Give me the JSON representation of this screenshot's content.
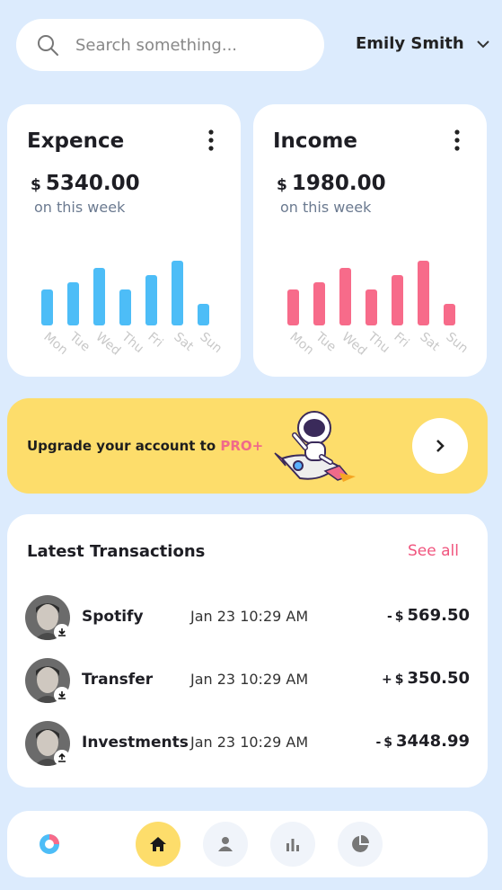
{
  "search": {
    "placeholder": "Search something..."
  },
  "user": {
    "name": "Emily Smith"
  },
  "expense": {
    "title": "Expence",
    "currency": "$",
    "amount": "5340.00",
    "subtitle": "on this week",
    "color": "#4dbdf7",
    "days": [
      "Mon",
      "Tue",
      "Wed",
      "Thu",
      "Fri",
      "Sat",
      "Sun"
    ],
    "values": [
      40,
      48,
      64,
      40,
      56,
      72,
      24
    ]
  },
  "income": {
    "title": "Income",
    "currency": "$",
    "amount": "1980.00",
    "subtitle": "on this week",
    "color": "#f76b8a",
    "days": [
      "Mon",
      "Tue",
      "Wed",
      "Thu",
      "Fri",
      "Sat",
      "Sun"
    ],
    "values": [
      40,
      48,
      64,
      40,
      56,
      72,
      24
    ]
  },
  "promo": {
    "text": "Upgrade your account to ",
    "highlight": "PRO+"
  },
  "transactions": {
    "title": "Latest Transactions",
    "see_all": "See all",
    "items": [
      {
        "name": "Spotify",
        "date": "Jan 23 10:29 AM",
        "sign": "-",
        "currency": "$",
        "amount": "569.50"
      },
      {
        "name": "Transfer",
        "date": "Jan 23 10:29 AM",
        "sign": "+",
        "currency": "$",
        "amount": "350.50"
      },
      {
        "name": "Investments",
        "date": "Jan 23 10:29 AM",
        "sign": "-",
        "currency": "$",
        "amount": "3448.99"
      }
    ]
  },
  "nav": {
    "items": [
      "home-icon",
      "user-icon",
      "bar-chart-icon",
      "pie-chart-icon"
    ],
    "active": "home-icon"
  },
  "colors": {
    "background": "#dcebfd",
    "accent_yellow": "#fddd6b",
    "pink": "#f0557e",
    "blue": "#4dbdf7"
  }
}
